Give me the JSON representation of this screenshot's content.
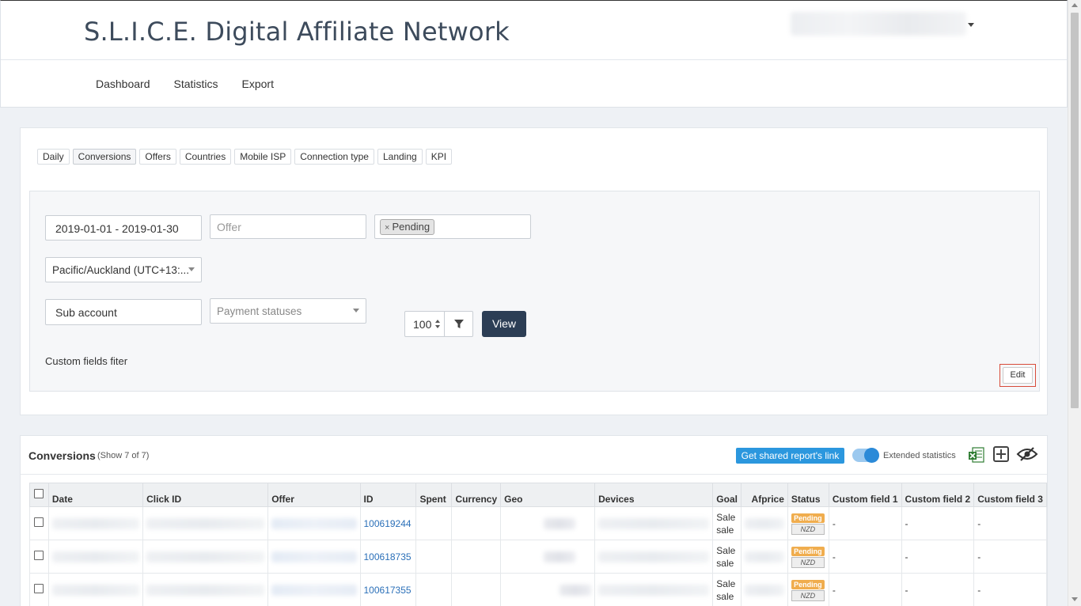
{
  "header": {
    "brand": "S.L.I.C.E. Digital Affiliate Network",
    "nav": [
      "Dashboard",
      "Statistics",
      "Export"
    ]
  },
  "tabs": [
    "Daily",
    "Conversions",
    "Offers",
    "Countries",
    "Mobile ISP",
    "Connection type",
    "Landing",
    "KPI"
  ],
  "active_tab": "Conversions",
  "filters": {
    "date_range": "2019-01-01 - 2019-01-30",
    "offer_placeholder": "Offer",
    "status_chip": "Pending",
    "timezone": "Pacific/Auckland (UTC+13:...",
    "sub_account": "Sub account",
    "payment_placeholder": "Payment statuses",
    "page_size": "100",
    "view_label": "View",
    "custom_fields_label": "Custom fields fiter",
    "edit_label": "Edit"
  },
  "conversions": {
    "title": "Conversions",
    "count": "(Show 7 of 7)",
    "share_label": "Get shared report's link",
    "extended_label": "Extended statistics",
    "columns": [
      "Date",
      "Click ID",
      "Offer",
      "ID",
      "Spent",
      "Currency",
      "Geo",
      "Devices",
      "Goal",
      "Afprice",
      "Status",
      "Custom field 1",
      "Custom field 2",
      "Custom field 3"
    ],
    "rows": [
      {
        "id": "100619244",
        "goal_line1": "Sale",
        "goal_line2": "sale",
        "status": "Pending",
        "currency": "NZD",
        "cf1": "-",
        "cf2": "-",
        "cf3": "-"
      },
      {
        "id": "100618735",
        "goal_line1": "Sale",
        "goal_line2": "sale",
        "status": "Pending",
        "currency": "NZD",
        "cf1": "-",
        "cf2": "-",
        "cf3": "-"
      },
      {
        "id": "100617355",
        "goal_line1": "Sale",
        "goal_line2": "sale",
        "status": "Pending",
        "currency": "NZD",
        "cf1": "-",
        "cf2": "-",
        "cf3": "-"
      }
    ]
  },
  "colors": {
    "brand_text": "#3d4b5c",
    "view_button": "#2c3e55",
    "share_button": "#2b97de",
    "pending_badge": "#f0ad4e",
    "link": "#2a6fb8"
  }
}
